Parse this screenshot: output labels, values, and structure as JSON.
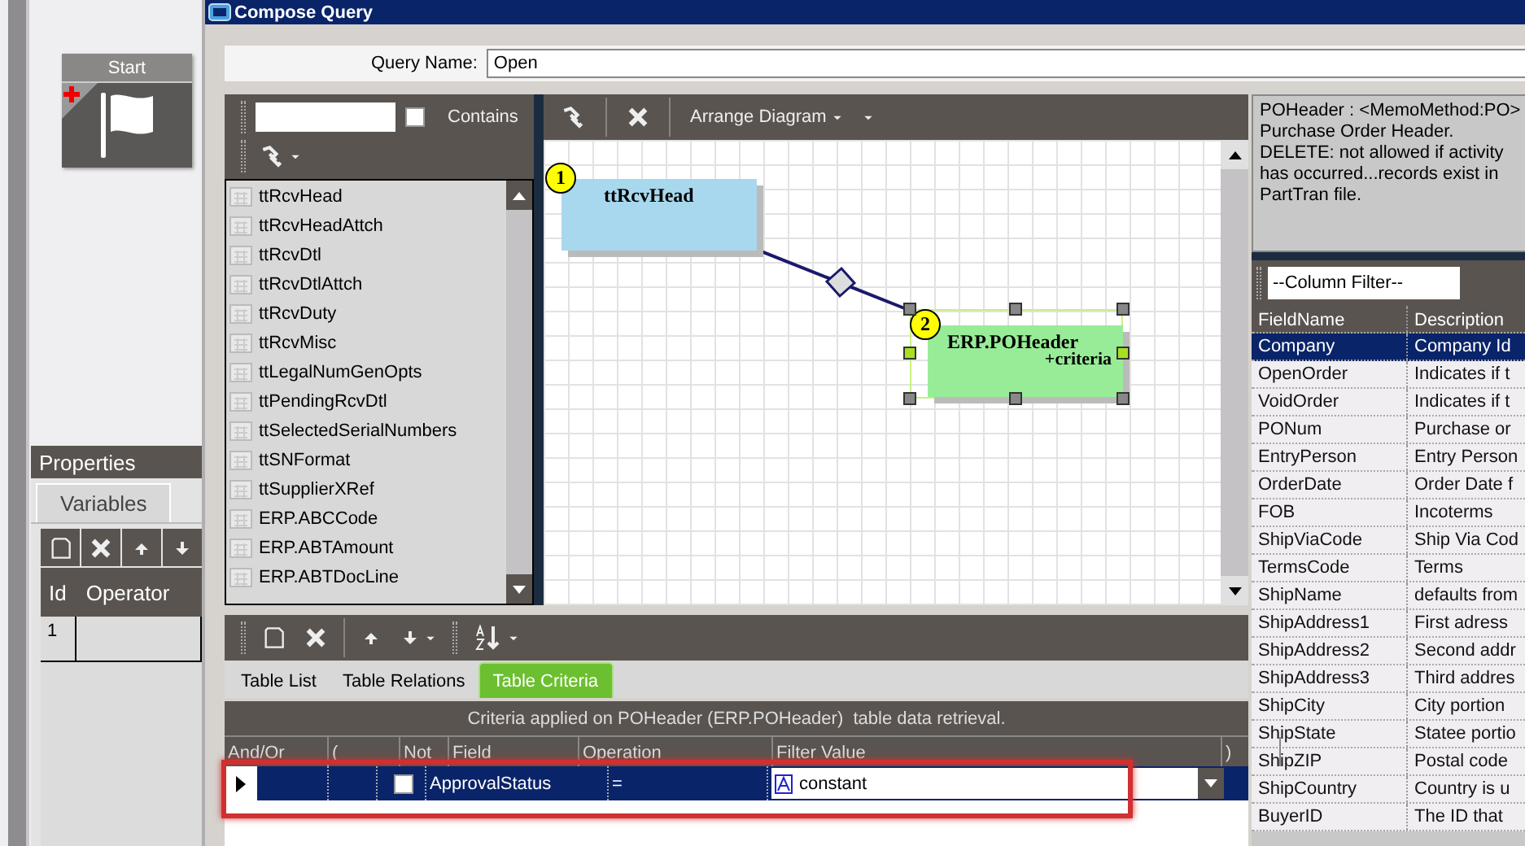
{
  "window": {
    "title": "Compose Query"
  },
  "workflow": {
    "start_node": {
      "label": "Start"
    },
    "properties": {
      "title": "Properties",
      "tabs": [
        {
          "label": "Variables",
          "selected": true
        }
      ],
      "columns": [
        "Id",
        "Operator"
      ],
      "rows": [
        [
          "1",
          ""
        ]
      ]
    }
  },
  "query_name": {
    "label": "Query Name:",
    "value": "Open"
  },
  "table_search": {
    "contains_label": "Contains",
    "contains_checked": false
  },
  "tables": [
    "ttRcvHead",
    "ttRcvHeadAttch",
    "ttRcvDtl",
    "ttRcvDtlAttch",
    "ttRcvDuty",
    "ttRcvMisc",
    "ttLegalNumGenOpts",
    "ttPendingRcvDtl",
    "ttSelectedSerialNumbers",
    "ttSNFormat",
    "ttSupplierXRef",
    "ERP.ABCCode",
    "ERP.ABTAmount",
    "ERP.ABTDocLine"
  ],
  "diagram": {
    "arrange_label": "Arrange Diagram",
    "nodes": [
      {
        "number": "1",
        "name": "ttRcvHead",
        "selected": false
      },
      {
        "number": "2",
        "name": "ERP.POHeader",
        "note": "+criteria",
        "selected": true
      }
    ]
  },
  "bottom_tabs": [
    {
      "label": "Table List",
      "selected": false
    },
    {
      "label": "Table Relations",
      "selected": false
    },
    {
      "label": "Table Criteria",
      "selected": true
    }
  ],
  "criteria": {
    "caption": "Criteria applied on POHeader (ERP.POHeader)  table data retrieval.",
    "columns": [
      "And/Or",
      "(",
      "Not",
      "Field",
      "Operation",
      "Filter Value",
      ")"
    ],
    "rows": [
      {
        "and_or": "",
        "paren": "",
        "not": false,
        "field": "ApprovalStatus",
        "operation": "=",
        "filter_value": "constant",
        "selected": true
      }
    ]
  },
  "description": "POHeader :  <MemoMethod:PO> Purchase Order Header. DELETE: not allowed if activity has occurred...records exist in PartTran file.",
  "column_filter": {
    "value": "--Column Filter--"
  },
  "fields": {
    "columns": [
      "FieldName",
      "Description"
    ],
    "rows": [
      {
        "name": "Company",
        "description": "Company Id",
        "selected": true
      },
      {
        "name": "OpenOrder",
        "description": "Indicates if t",
        "selected": false
      },
      {
        "name": "VoidOrder",
        "description": "Indicates if t",
        "selected": false
      },
      {
        "name": "PONum",
        "description": "Purchase or",
        "selected": false
      },
      {
        "name": "EntryPerson",
        "description": "Entry Person",
        "selected": false
      },
      {
        "name": "OrderDate",
        "description": "Order Date f",
        "selected": false
      },
      {
        "name": "FOB",
        "description": "Incoterms",
        "selected": false
      },
      {
        "name": "ShipViaCode",
        "description": "Ship Via Cod",
        "selected": false
      },
      {
        "name": "TermsCode",
        "description": "Terms",
        "selected": false
      },
      {
        "name": "ShipName",
        "description": "defaults from",
        "selected": false
      },
      {
        "name": "ShipAddress1",
        "description": "First adress",
        "selected": false
      },
      {
        "name": "ShipAddress2",
        "description": "Second addr",
        "selected": false
      },
      {
        "name": "ShipAddress3",
        "description": "Third addres",
        "selected": false
      },
      {
        "name": "ShipCity",
        "description": "City portion",
        "selected": false
      },
      {
        "name": "ShipState",
        "description": "Statee portio",
        "selected": false
      },
      {
        "name": "ShipZIP",
        "description": "Postal code",
        "selected": false
      },
      {
        "name": "ShipCountry",
        "description": "Country is u",
        "selected": false
      },
      {
        "name": "BuyerID",
        "description": "The ID that",
        "selected": false
      }
    ]
  }
}
